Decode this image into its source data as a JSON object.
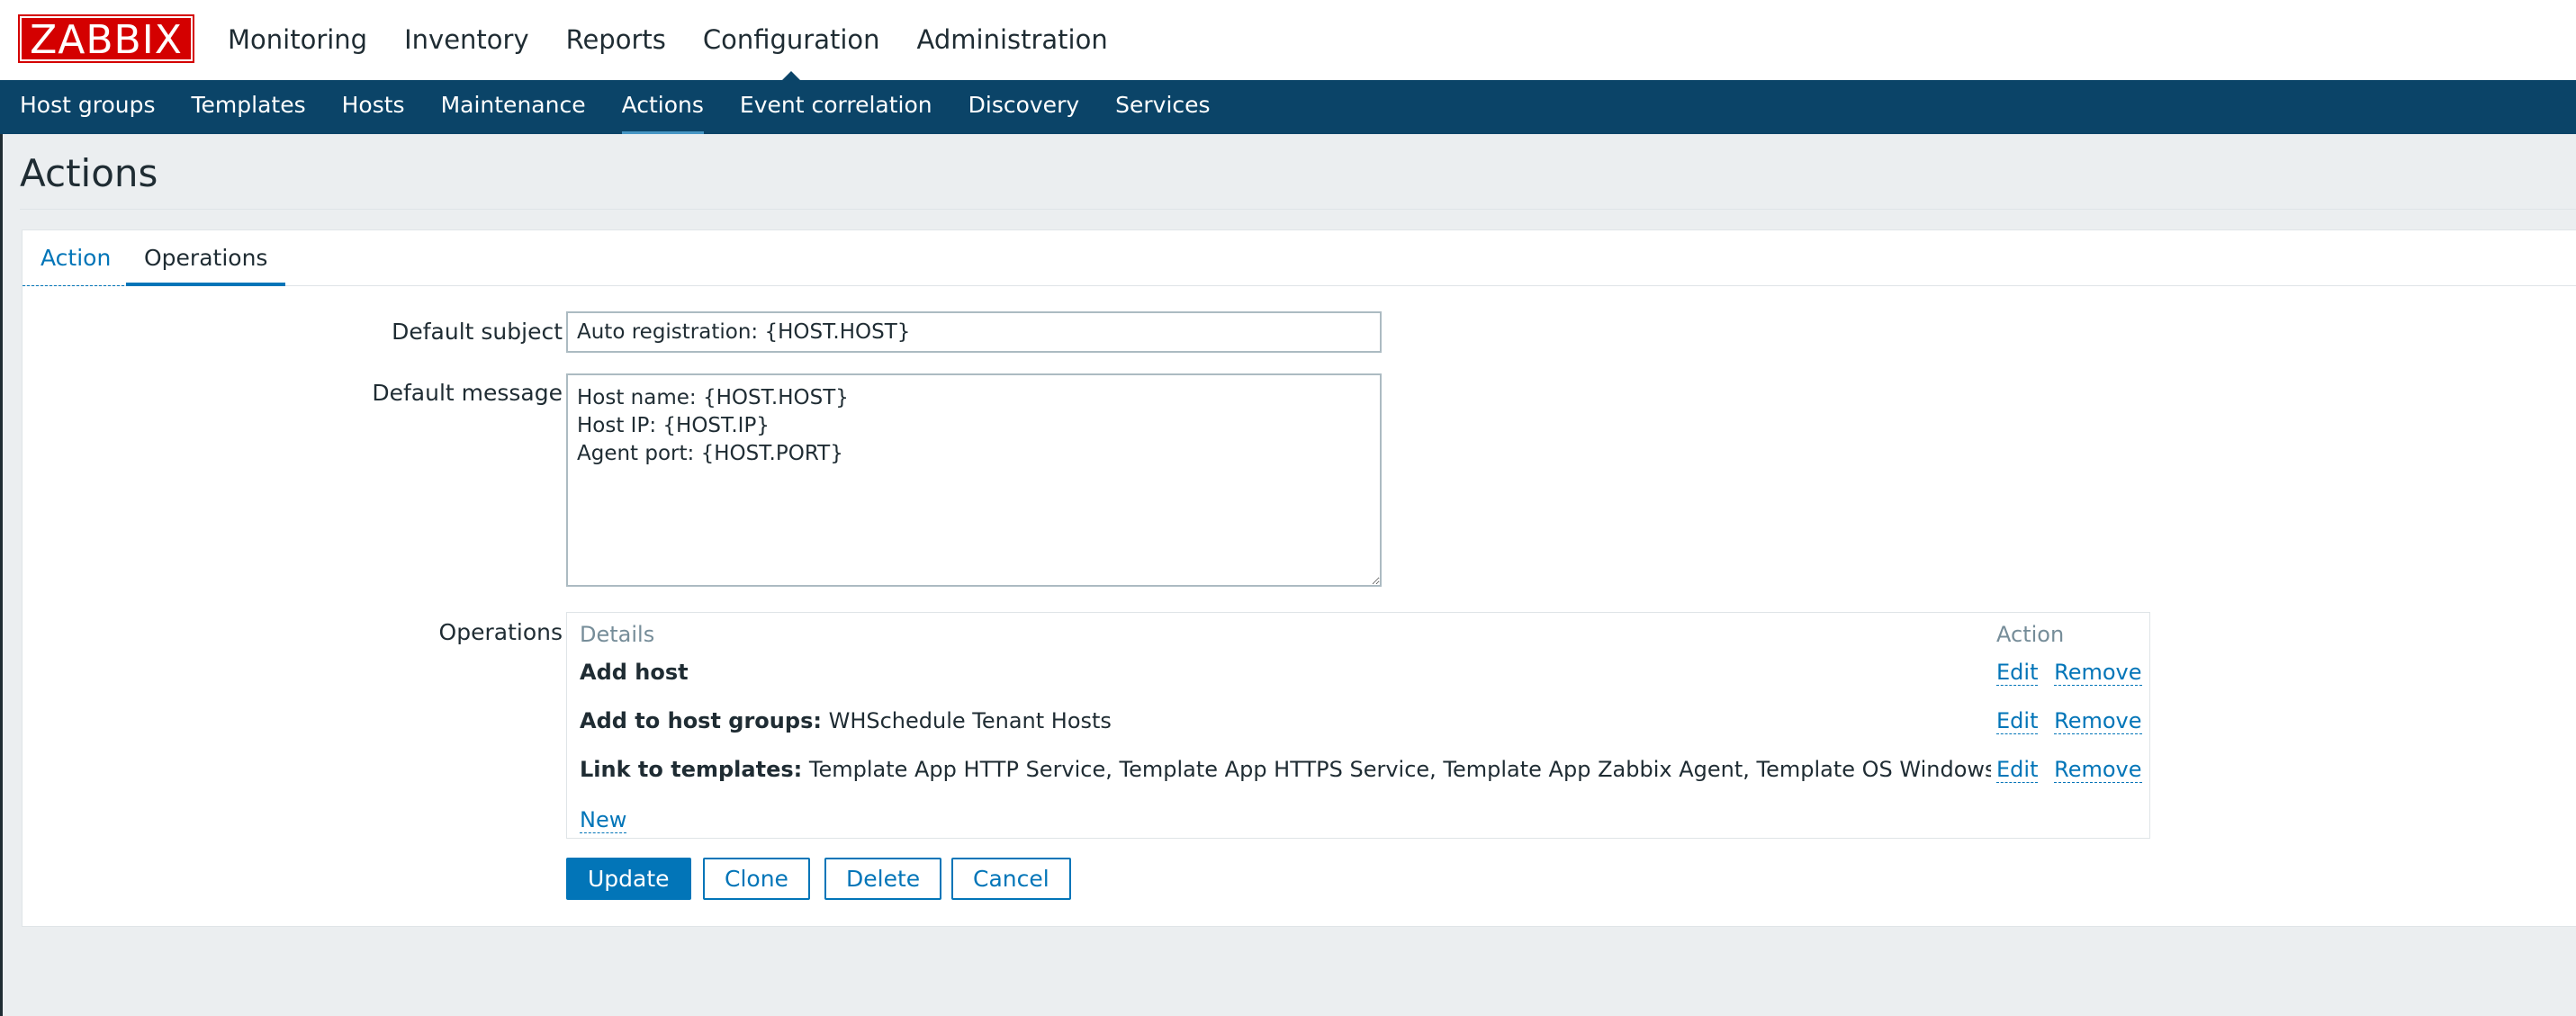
{
  "logo": "ZABBIX",
  "top_menu": [
    {
      "label": "Monitoring",
      "active": false
    },
    {
      "label": "Inventory",
      "active": false
    },
    {
      "label": "Reports",
      "active": false
    },
    {
      "label": "Configuration",
      "active": true
    },
    {
      "label": "Administration",
      "active": false
    }
  ],
  "sub_menu": [
    {
      "label": "Host groups",
      "active": false
    },
    {
      "label": "Templates",
      "active": false
    },
    {
      "label": "Hosts",
      "active": false
    },
    {
      "label": "Maintenance",
      "active": false
    },
    {
      "label": "Actions",
      "active": true
    },
    {
      "label": "Event correlation",
      "active": false
    },
    {
      "label": "Discovery",
      "active": false
    },
    {
      "label": "Services",
      "active": false
    }
  ],
  "page_title": "Actions",
  "tabs": [
    {
      "label": "Action",
      "active": false
    },
    {
      "label": "Operations",
      "active": true
    }
  ],
  "form": {
    "default_subject_label": "Default subject",
    "default_subject_value": "Auto registration: {HOST.HOST}",
    "default_message_label": "Default message",
    "default_message_value": "Host name: {HOST.HOST}\nHost IP: {HOST.IP}\nAgent port: {HOST.PORT}",
    "operations_label": "Operations"
  },
  "operations": {
    "col_details": "Details",
    "col_action": "Action",
    "rows": [
      {
        "bold": "Add host",
        "rest": "",
        "edit": "Edit",
        "remove": "Remove"
      },
      {
        "bold": "Add to host groups:",
        "rest": " WHSchedule Tenant Hosts",
        "edit": "Edit",
        "remove": "Remove"
      },
      {
        "bold": "Link to templates:",
        "rest": " Template App HTTP Service, Template App HTTPS Service, Template App Zabbix Agent, Template OS Windows Wohi",
        "edit": "Edit",
        "remove": "Remove"
      }
    ],
    "new_label": "New"
  },
  "buttons": {
    "update": "Update",
    "clone": "Clone",
    "delete": "Delete",
    "cancel": "Cancel"
  },
  "colors": {
    "brand_red": "#d40000",
    "nav_blue": "#0b4468",
    "link_blue": "#0275b8"
  }
}
